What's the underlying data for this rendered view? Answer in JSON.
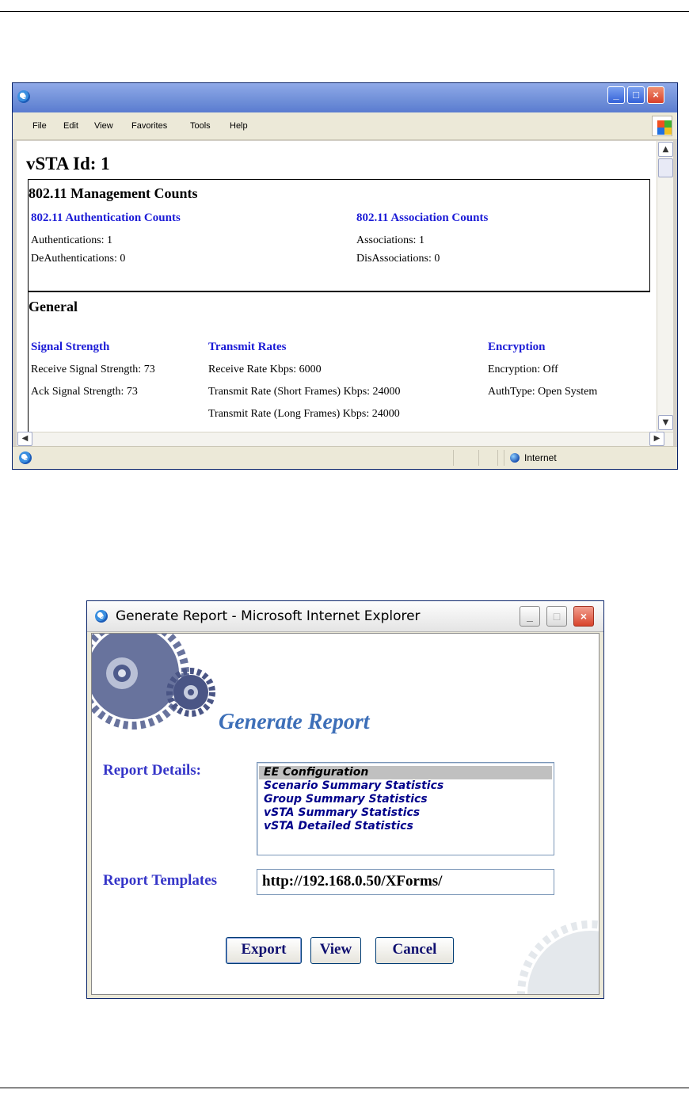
{
  "browser": {
    "menu": [
      "File",
      "Edit",
      "View",
      "Favorites",
      "Tools",
      "Help"
    ],
    "vsta_title": "vSTA Id: 1",
    "management": {
      "heading": "802.11 Management Counts",
      "auth_heading": "802.11 Authentication Counts",
      "auth_lines": [
        "Authentications: 1",
        "DeAuthentications: 0"
      ],
      "assoc_heading": "802.11 Association Counts",
      "assoc_lines": [
        "Associations: 1",
        "DisAssociations: 0"
      ]
    },
    "general": {
      "heading": "General",
      "signal_heading": "Signal Strength",
      "signal_lines": [
        "Receive Signal Strength: 73",
        "Ack Signal Strength: 73"
      ],
      "rates_heading": "Transmit Rates",
      "rates_lines": [
        "Receive Rate Kbps: 6000",
        "Transmit Rate (Short Frames) Kbps: 24000",
        "Transmit Rate (Long Frames) Kbps: 24000"
      ],
      "enc_heading": "Encryption",
      "enc_lines": [
        "Encryption: Off",
        "AuthType: Open System"
      ]
    },
    "status_zone": "Internet"
  },
  "report": {
    "window_title": "Generate Report - Microsoft Internet Explorer",
    "title": "Generate Report",
    "details_label": "Report Details:",
    "details_options": [
      "EE Configuration",
      "Scenario Summary Statistics",
      "Group Summary Statistics",
      "vSTA Summary Statistics",
      "vSTA Detailed Statistics"
    ],
    "templates_label": "Report Templates",
    "templates_value": "http://192.168.0.50/XForms/",
    "buttons": {
      "export": "Export",
      "view": "View",
      "cancel": "Cancel"
    }
  },
  "icons": {
    "browser_icon": "ie-icon",
    "windows_logo": "windows-flag-icon",
    "zone_icon": "globe-icon",
    "gear_art": "gear-icon"
  },
  "colors": {
    "section_heading": "#1b1bd6",
    "field_label": "#3535c8",
    "report_title": "#3d6fb8",
    "list_text": "#00008a",
    "title_bar": "#6f8fd8"
  }
}
